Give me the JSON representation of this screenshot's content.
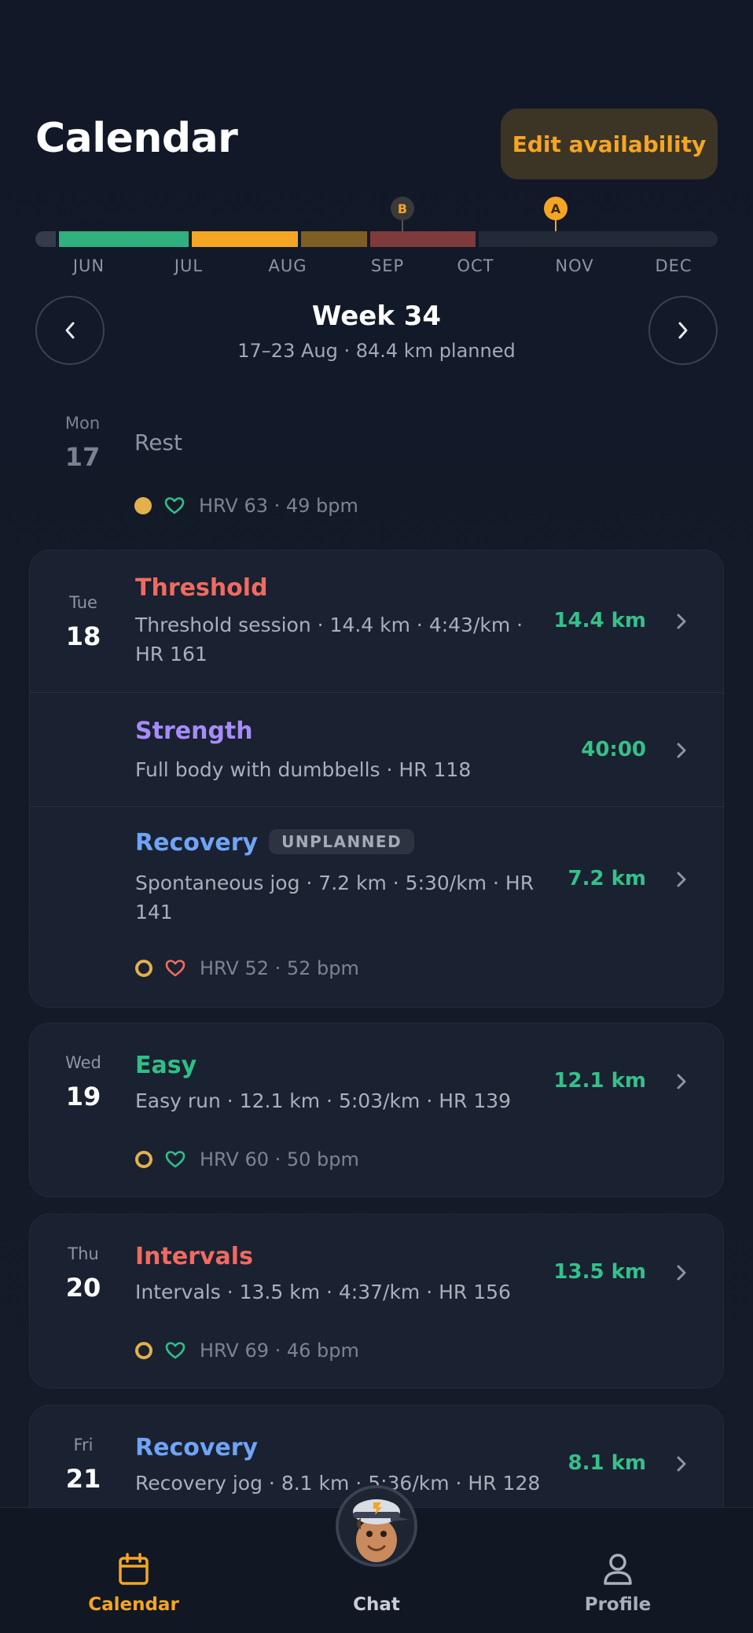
{
  "header": {
    "title": "Calendar",
    "edit_button": "Edit availability"
  },
  "timeline": {
    "months": [
      "JUN",
      "JUL",
      "AUG",
      "SEP",
      "OCT",
      "NOV",
      "DEC"
    ],
    "races": [
      "B",
      "A"
    ],
    "colors": {
      "base": "#2fb07e",
      "build": "#f5a524",
      "taper": "#7d5e25",
      "peak": "#7f3b3b",
      "future": "#222a38"
    }
  },
  "week": {
    "title": "Week 34",
    "subtitle": "17–23 Aug · 84.4 km planned"
  },
  "days": [
    {
      "dow": "Mon",
      "dom": "17",
      "rest_label": "Rest",
      "readiness": "HRV 63 · 49 bpm",
      "heart": "green"
    },
    {
      "dow": "Tue",
      "dom": "18",
      "workouts": [
        {
          "title": "Threshold",
          "desc": "Threshold session · 14.4 km · 4:43/km · HR 161",
          "metric": "14.4 km",
          "color": "#ef6b61"
        },
        {
          "title": "Strength",
          "desc": "Full body with dumbbells · HR 118",
          "metric": "40:00",
          "color": "#a78bfa"
        },
        {
          "title": "Recovery",
          "badge": "UNPLANNED",
          "desc": "Spontaneous jog · 7.2 km · 5:30/km · HR 141",
          "metric": "7.2 km",
          "color": "#6fa4f7"
        }
      ],
      "readiness": "HRV 52 · 52 bpm",
      "heart": "red"
    },
    {
      "dow": "Wed",
      "dom": "19",
      "workouts": [
        {
          "title": "Easy",
          "desc": "Easy run · 12.1 km · 5:03/km · HR 139",
          "metric": "12.1 km",
          "color": "#2fbf86"
        }
      ],
      "readiness": "HRV 60 · 50 bpm",
      "heart": "green"
    },
    {
      "dow": "Thu",
      "dom": "20",
      "workouts": [
        {
          "title": "Intervals",
          "desc": "Intervals · 13.5 km · 4:37/km · HR 156",
          "metric": "13.5 km",
          "color": "#ef6b61"
        }
      ],
      "readiness": "HRV 69 · 46 bpm",
      "heart": "green"
    },
    {
      "dow": "Fri",
      "dom": "21",
      "workouts": [
        {
          "title": "Recovery",
          "desc": "Recovery jog · 8.1 km · 5:36/km · HR 128",
          "metric": "8.1 km",
          "color": "#6fa4f7"
        }
      ]
    }
  ],
  "nav": {
    "calendar": "Calendar",
    "chat": "Chat",
    "profile": "Profile"
  },
  "icons": [
    "chevron-left-icon",
    "chevron-right-icon",
    "heart-icon",
    "calendar-icon",
    "coach-avatar",
    "profile-icon"
  ]
}
